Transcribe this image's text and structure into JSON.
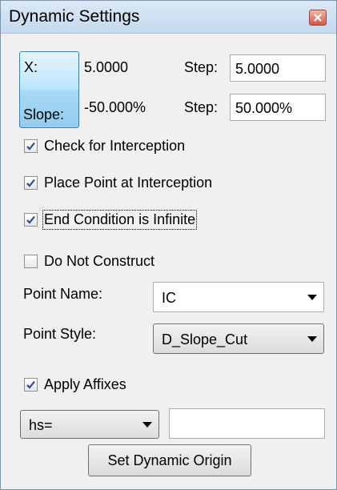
{
  "window": {
    "title": "Dynamic Settings"
  },
  "axis_button": {
    "x_label": "X:",
    "slope_label": "Slope:"
  },
  "x_row": {
    "value": "5.0000",
    "step_label": "Step:",
    "step_value": "5.0000"
  },
  "slope_row": {
    "value": "-50.000%",
    "step_label": "Step:",
    "step_value": "50.000%"
  },
  "checkboxes": {
    "check_interception": {
      "label": "Check for Interception",
      "checked": true
    },
    "place_point": {
      "label": "Place Point at Interception",
      "checked": true
    },
    "end_condition": {
      "label": "End Condition is Infinite",
      "checked": true
    },
    "do_not_construct": {
      "label": "Do Not Construct",
      "checked": false
    },
    "apply_affixes": {
      "label": "Apply Affixes",
      "checked": true
    }
  },
  "point_name": {
    "label": "Point Name:",
    "value": "IC"
  },
  "point_style": {
    "label": "Point Style:",
    "value": "D_Slope_Cut"
  },
  "affix": {
    "mode_value": "hs=",
    "text_value": ""
  },
  "set_origin_button": {
    "label": "Set Dynamic Origin"
  },
  "colors": {
    "title_bar": "#c6d9ef",
    "selected_button": "#a7d9f5",
    "check_mark": "#2a4a9a",
    "close_button": "#d2584a"
  },
  "icons": {
    "close": "close-icon",
    "check": "checkmark-icon",
    "dropdown": "chevron-down-icon"
  }
}
